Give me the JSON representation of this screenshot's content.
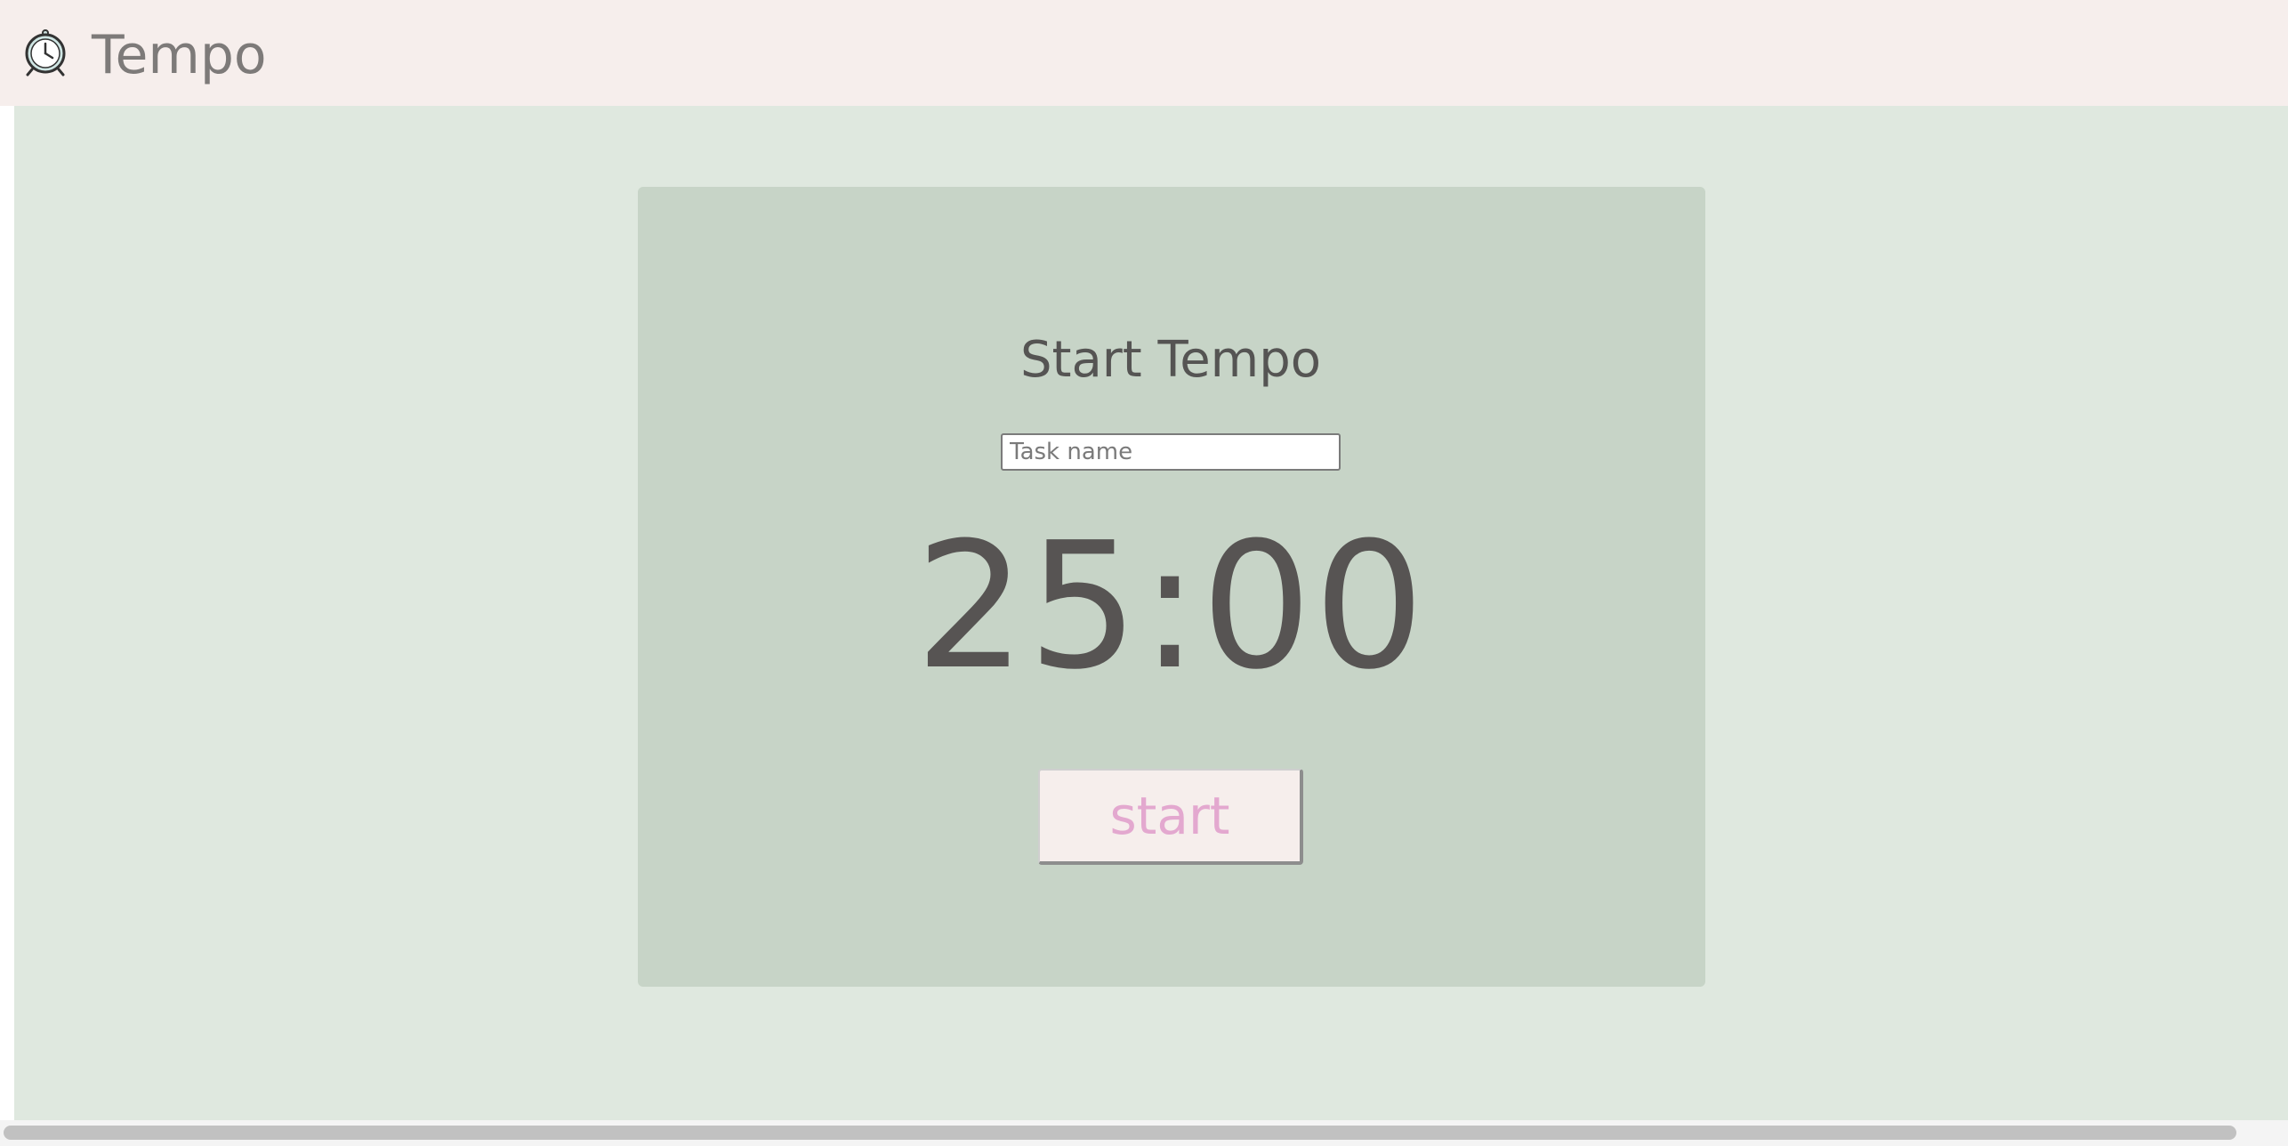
{
  "app": {
    "title": "Tempo",
    "logo_icon": "alarm-clock-icon"
  },
  "card": {
    "title": "Start Tempo",
    "task_input": {
      "value": "",
      "placeholder": "Task name"
    },
    "timer": "25:00",
    "start_label": "start"
  },
  "colors": {
    "header_bg": "#f6eeec",
    "main_bg": "#dfe8df",
    "card_bg": "#c7d4c7",
    "start_text": "#e3a8cf",
    "timer_text": "#575453"
  }
}
